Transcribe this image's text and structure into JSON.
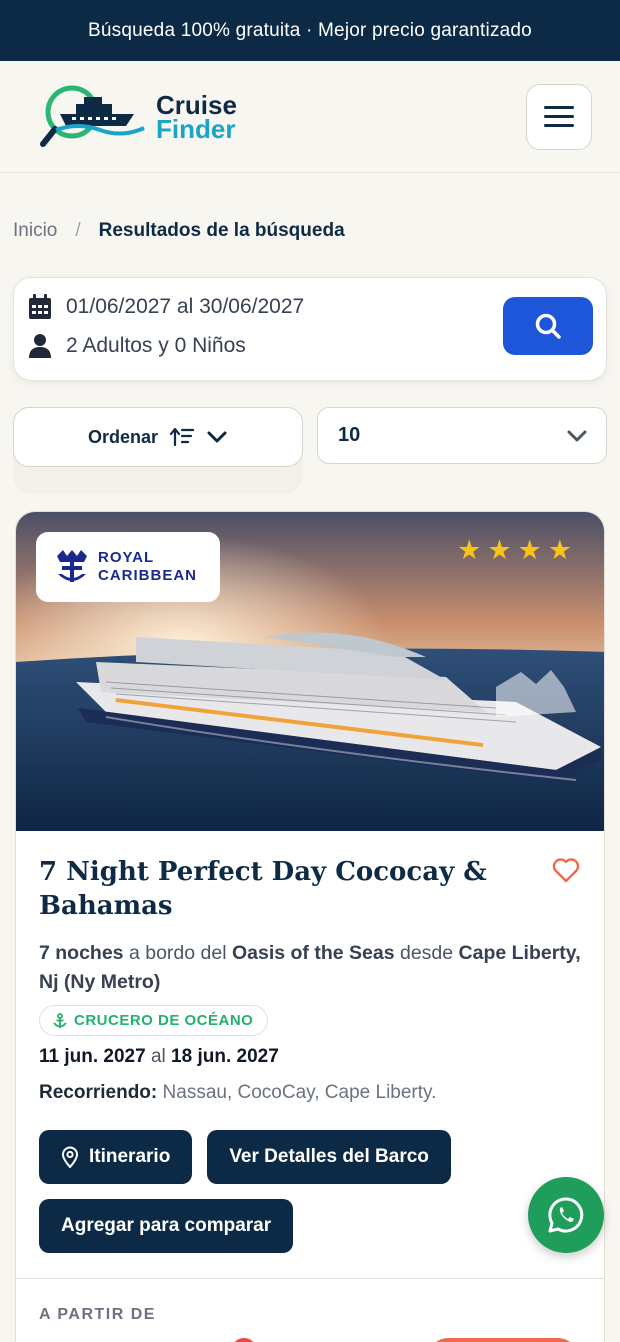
{
  "topbar": {
    "text": "Búsqueda 100% gratuita · Mejor precio garantizado"
  },
  "header": {
    "logo_line1": "Cruise",
    "logo_line2": "Finder",
    "menu_icon": "hamburger-icon"
  },
  "breadcrumb": {
    "home": "Inicio",
    "separator": "/",
    "current": "Resultados de la búsqueda"
  },
  "search": {
    "dates": "01/06/2027 al 30/06/2027",
    "guests": "2 Adultos y 0 Niños",
    "calendar_icon": "calendar-icon",
    "user_icon": "user-icon",
    "search_icon": "search-icon"
  },
  "controls": {
    "sort_label": "Ordenar",
    "per_page_value": "10"
  },
  "result": {
    "brand": {
      "line1": "ROYAL",
      "line2": "CARIBBEAN"
    },
    "stars": 4,
    "title": "7 Night Perfect Day Cococay & Bahamas",
    "nights": "7 noches",
    "aboard_text": "a bordo del",
    "ship": "Oasis of the Seas",
    "from_text": "desde",
    "port": "Cape Liberty, Nj (Ny Metro)",
    "tag": "CRUCERO DE OCÉANO",
    "start_date": "11 jun. 2027",
    "date_sep": "al",
    "end_date": "18 jun. 2027",
    "route_label": "Recorriendo:",
    "route": "Nassau, CocoCay, Cape Liberty.",
    "buttons": {
      "itinerary": "Itinerario",
      "ship_details": "Ver Detalles del Barco",
      "compare": "Agregar para comparar"
    },
    "price_from": "A PARTIR DE"
  },
  "colors": {
    "navy": "#0c2a45",
    "accent_blue": "#1d56d8",
    "whatsapp": "#1f9d5a",
    "star": "#f7c31a",
    "tag_green": "#23b26d"
  }
}
